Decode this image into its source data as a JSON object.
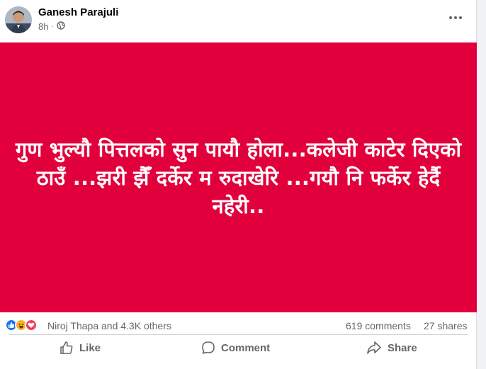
{
  "post": {
    "author": "Ganesh Parajuli",
    "time": "8h",
    "privacy_icon": "globe-icon",
    "more_icon": "more-options-icon",
    "background_color": "#e1003c",
    "text": "गुण भुल्यौ पित्तलको सुन पायौ होला...कलेजी काटेर दिएको ठाउँ ...झरी झैँ दर्केर म रुदाखेरि ...गयौ नि फर्केर हेर्दै नहेरी.."
  },
  "stats": {
    "reaction_icons": [
      "like-icon",
      "haha-icon",
      "love-icon"
    ],
    "reactors": "Niroj Thapa and 4.3K others",
    "comments": "619 comments",
    "shares": "27 shares"
  },
  "actions": {
    "like": "Like",
    "comment": "Comment",
    "share": "Share"
  },
  "colors": {
    "accent": "#1877f2",
    "haha": "#f7b125",
    "love": "#f33e58",
    "muted_text": "#65676b"
  }
}
